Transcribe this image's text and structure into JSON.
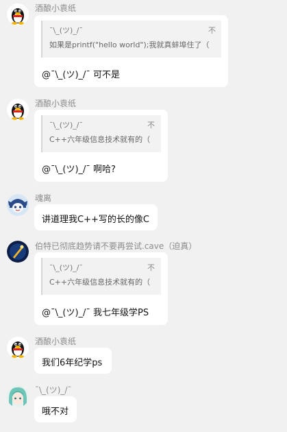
{
  "messages": [
    {
      "sender": "酒酿小袁纸",
      "avatar": "qq-penguin-avatar",
      "quote": {
        "author": "¯\\_(ツ)_/¯",
        "text": "如果是printf(\"hello world\");我就真蚌埠住了（",
        "icon": "不"
      },
      "text": "@¯\\_(ツ)_/¯  可不是"
    },
    {
      "sender": "酒酿小袁纸",
      "avatar": "qq-penguin-avatar",
      "quote": {
        "author": "¯\\_(ツ)_/¯",
        "text": "C++六年级信息技术就有的（",
        "icon": "不"
      },
      "text": "@¯\\_(ツ)_/¯  啊哈?"
    },
    {
      "sender": "魂离",
      "avatar": "anime-character-avatar",
      "text": "讲道理我C++写的长的像C"
    },
    {
      "sender": "伯特已彻底趋势请不要再尝试.cave（迫真）",
      "avatar": "dark-blue-avatar",
      "quote": {
        "author": "¯\\_(ツ)_/¯",
        "text": "C++六年级信息技术就有的（",
        "icon": "不"
      },
      "text": "@¯\\_(ツ)_/¯ 我七年级学PS"
    },
    {
      "sender": "酒酿小袁纸",
      "avatar": "qq-penguin-avatar",
      "text": "我们6年纪学ps"
    },
    {
      "sender": "¯\\_(ツ)_/¯",
      "avatar": "anime-girl-avatar",
      "text": "哦不对"
    }
  ]
}
